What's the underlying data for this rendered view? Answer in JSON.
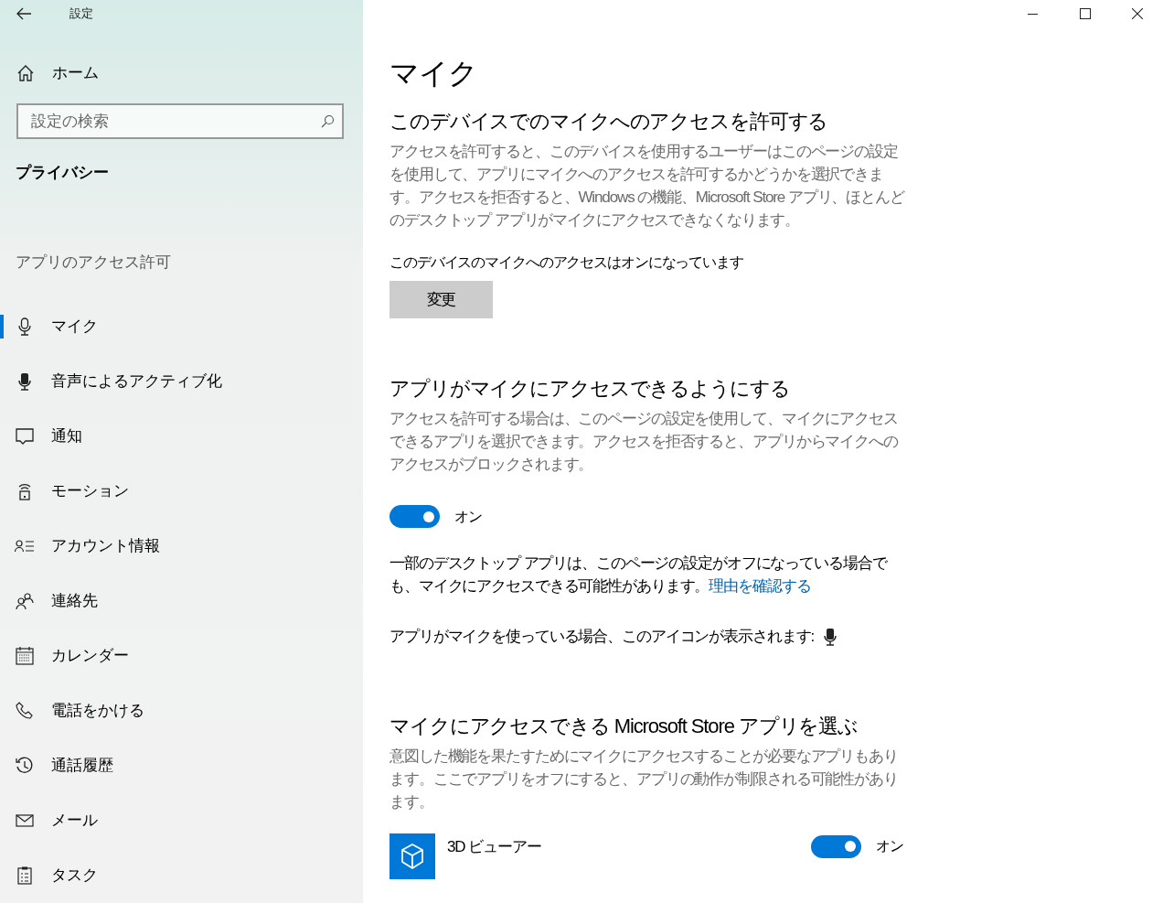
{
  "window": {
    "title": "設定"
  },
  "sidebar": {
    "home": "ホーム",
    "search": {
      "placeholder": "設定の検索"
    },
    "category": "プライバシー",
    "section": "アプリのアクセス許可",
    "items": [
      {
        "label": "マイク",
        "kind": "mic",
        "selected": true
      },
      {
        "label": "音声によるアクティブ化",
        "kind": "voice",
        "selected": false
      },
      {
        "label": "通知",
        "kind": "notification",
        "selected": false
      },
      {
        "label": "モーション",
        "kind": "motion",
        "selected": false
      },
      {
        "label": "アカウント情報",
        "kind": "account",
        "selected": false
      },
      {
        "label": "連絡先",
        "kind": "contacts",
        "selected": false
      },
      {
        "label": "カレンダー",
        "kind": "calendar",
        "selected": false
      },
      {
        "label": "電話をかける",
        "kind": "phone",
        "selected": false
      },
      {
        "label": "通話履歴",
        "kind": "history",
        "selected": false
      },
      {
        "label": "メール",
        "kind": "mail",
        "selected": false
      },
      {
        "label": "タスク",
        "kind": "tasks",
        "selected": false
      }
    ]
  },
  "main": {
    "title": "マイク",
    "device_section": {
      "heading": "このデバイスでのマイクへのアクセスを許可する",
      "description": "アクセスを許可すると、このデバイスを使用するユーザーはこのページの設定を使用して、アプリにマイクへのアクセスを許可するかどうかを選択できます。アクセスを拒否すると、Windows の機能、Microsoft Store アプリ、ほとんどのデスクトップ アプリがマイクにアクセスできなくなります。",
      "status": "このデバイスのマイクへのアクセスはオンになっています",
      "button": "変更"
    },
    "apps_section": {
      "heading": "アプリがマイクにアクセスできるようにする",
      "description": "アクセスを許可する場合は、このページの設定を使用して、マイクにアクセスできるアプリを選択できます。アクセスを拒否すると、アプリからマイクへのアクセスがブロックされます。",
      "toggle": {
        "on": true,
        "label": "オン"
      },
      "note": "一部のデスクトップ アプリは、このページの設定がオフになっている場合でも、マイクにアクセスできる可能性があります。",
      "link": "理由を確認する",
      "icon_note": "アプリがマイクを使っている場合、このアイコンが表示されます:"
    },
    "store_section": {
      "heading": "マイクにアクセスできる Microsoft Store アプリを選ぶ",
      "description": "意図した機能を果たすためにマイクにアクセスすることが必要なアプリもあります。ここでアプリをオフにすると、アプリの動作が制限される可能性があります。",
      "apps": [
        {
          "name": "3D ビューアー",
          "on": true,
          "label": "オン"
        }
      ]
    }
  }
}
